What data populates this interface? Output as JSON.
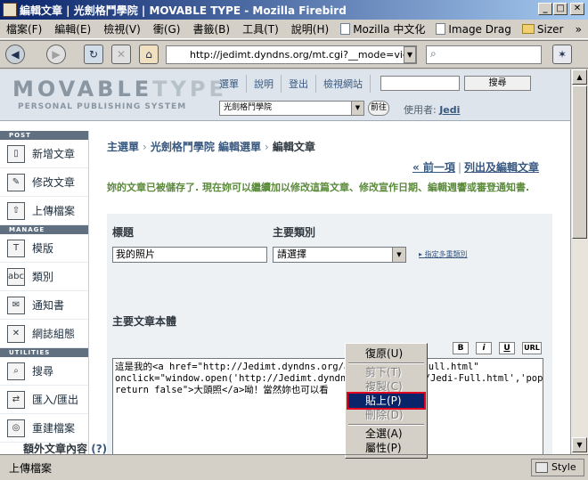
{
  "window": {
    "title": "編輯文章 | 光劍格鬥學院 | MOVABLE TYPE - Mozilla Firebird"
  },
  "menubar": {
    "items": [
      "檔案(F)",
      "編輯(E)",
      "檢視(V)",
      "衝(G)",
      "書籤(B)",
      "工具(T)",
      "說明(H)"
    ],
    "bookmarks": [
      "Mozilla 中文化",
      "Image Drag",
      "Sizer"
    ],
    "overflow": "»"
  },
  "navbar": {
    "url": "http://jedimt.dyndns.org/mt.cgi?__mode=view&_ty"
  },
  "mt_header": {
    "logo_movable": "MOVABLE",
    "logo_type": "TYPE",
    "tagline": "PERSONAL PUBLISHING SYSTEM",
    "nav": [
      "選單",
      "說明",
      "登出",
      "檢視網站"
    ],
    "search_button": "搜尋",
    "blog_select": "光劍格鬥學院",
    "go_button": "前往",
    "user_label": "使用者:",
    "user_name": "Jedi"
  },
  "sidebar": {
    "sections": {
      "post": "POST",
      "manage": "MANAGE",
      "utilities": "UTILITIES"
    },
    "post_items": [
      "新增文章",
      "修改文章",
      "上傳檔案"
    ],
    "manage_items": [
      "模版",
      "類別",
      "通知書",
      "網誌組態"
    ],
    "util_items": [
      "搜尋",
      "匯入/匯出",
      "重建檔案"
    ]
  },
  "main": {
    "breadcrumb": [
      "主選單",
      "光劍格鬥學院 編輯選單",
      "編輯文章"
    ],
    "breadcrumb_sep": "›",
    "prev": "« 前一項",
    "sep": "|",
    "list": "列出及編輯文章",
    "saved_msg": "妳的文章已被儲存了. 現在妳可以繼續加以修改這篇文章、修改宣作日期、編輯週響或審登通知書.",
    "title_label": "標題",
    "title_value": "我的照片",
    "category_label": "主要類別",
    "category_value": "請選擇",
    "multi_category": "指定多重類別",
    "body_label": "主要文章本體",
    "format_buttons": [
      "B",
      "i",
      "U",
      "URL"
    ],
    "body_lines": [
      "這是我的<a href=\"http://Jedimt.dyndns.org/archives/Jedi-Full.html\"",
      "onclick=\"window.open('http://Jedimt.dyndns.org/archives/Jedi-Full.html','popup','wi",
      "return false\">大頭照</a>呦！當然妳也可以看"
    ],
    "extra_label": "額外文章內容",
    "extra_help": "(?)"
  },
  "context_menu": {
    "undo": "復原(U)",
    "cut": "剪下(T)",
    "copy": "複製(C)",
    "paste": "貼上(P)",
    "delete": "刪除(D)",
    "select_all": "全選(A)",
    "properties": "屬性(P)"
  },
  "status": {
    "text": "上傳檔案",
    "style_button": "Style"
  }
}
